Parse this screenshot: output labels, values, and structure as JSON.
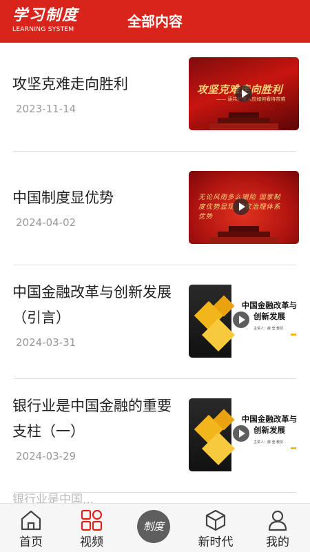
{
  "header": {
    "logo_cn": "学习制度",
    "logo_en": "LEARNING SYSTEM",
    "title": "全部内容",
    "background": "#d9241c"
  },
  "items": [
    {
      "title": "攻坚克难走向胜利",
      "date": "2023-11-14",
      "thumb_text": "攻坚克难走向胜利",
      "thumb_sub": "—— 读共产党人应如何看待苦难"
    },
    {
      "title": "中国制度显优势",
      "date": "2024-04-02",
      "thumb_text": "无论风雨多么艰险 国家制度优势显现 国家治理体系优势"
    },
    {
      "title": "中国金融改革与创新发展（引言）",
      "date": "2024-03-31",
      "thumb_text": "中国金融改革与创新发展",
      "thumb_sub": "主讲人：薛 莹 教授"
    },
    {
      "title": "银行业是中国金融的重要支柱（一）",
      "date": "2024-03-29",
      "thumb_text": "中国金融改革与创新发展",
      "thumb_sub": "主讲人：薛 莹 教授"
    }
  ],
  "partial_item": "银行业是中国...",
  "tabbar": {
    "items": [
      {
        "label": "首页",
        "icon": "home-icon"
      },
      {
        "label": "视频",
        "icon": "video-grid-icon",
        "active_color": "#d9241c"
      },
      {
        "label": "新时代",
        "icon": "cube-icon"
      },
      {
        "label": "我的",
        "icon": "user-icon"
      }
    ],
    "center_label": "制度"
  }
}
